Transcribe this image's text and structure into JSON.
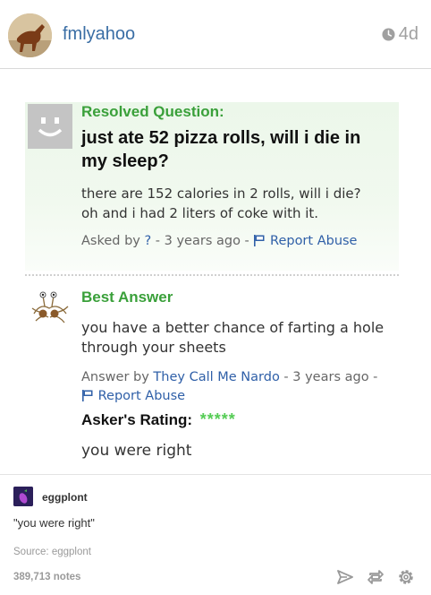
{
  "header": {
    "username": "fmlyahoo",
    "time_ago": "4d"
  },
  "screenshot": {
    "question": {
      "label": "Resolved Question:",
      "title": "just ate 52 pizza rolls, will i die in my sleep?",
      "body_line1": "there are 152 calories in 2 rolls, will i die?",
      "body_line2": "oh and i had 2 liters of coke with it.",
      "asked_by_prefix": "Asked by",
      "asker": "?",
      "asked_time": "- 3 years ago -",
      "report_abuse": "Report Abuse"
    },
    "answer": {
      "label": "Best Answer",
      "body": "you have a better chance of farting a hole through your sheets",
      "answer_by_prefix": "Answer by",
      "answerer": "They Call Me Nardo",
      "answer_time": "- 3 years ago -",
      "report_abuse": "Report Abuse",
      "rating_label": "Asker's Rating:",
      "rating_stars": "*****",
      "rating_value": 5,
      "reply": "you were right"
    }
  },
  "post": {
    "source_username": "eggplont",
    "caption": "\"you were right\"",
    "source_line": "Source: eggplont",
    "notes": "389,713 notes"
  },
  "icons": {
    "clock": "clock-icon",
    "flag": "flag-icon",
    "send": "send-icon",
    "reblog": "reblog-icon",
    "settings": "gear-icon"
  },
  "colors": {
    "username": "#3a6ea5",
    "yahoo_green": "#3aa03a",
    "link_blue": "#3060a8",
    "star_green": "#55cc55"
  }
}
